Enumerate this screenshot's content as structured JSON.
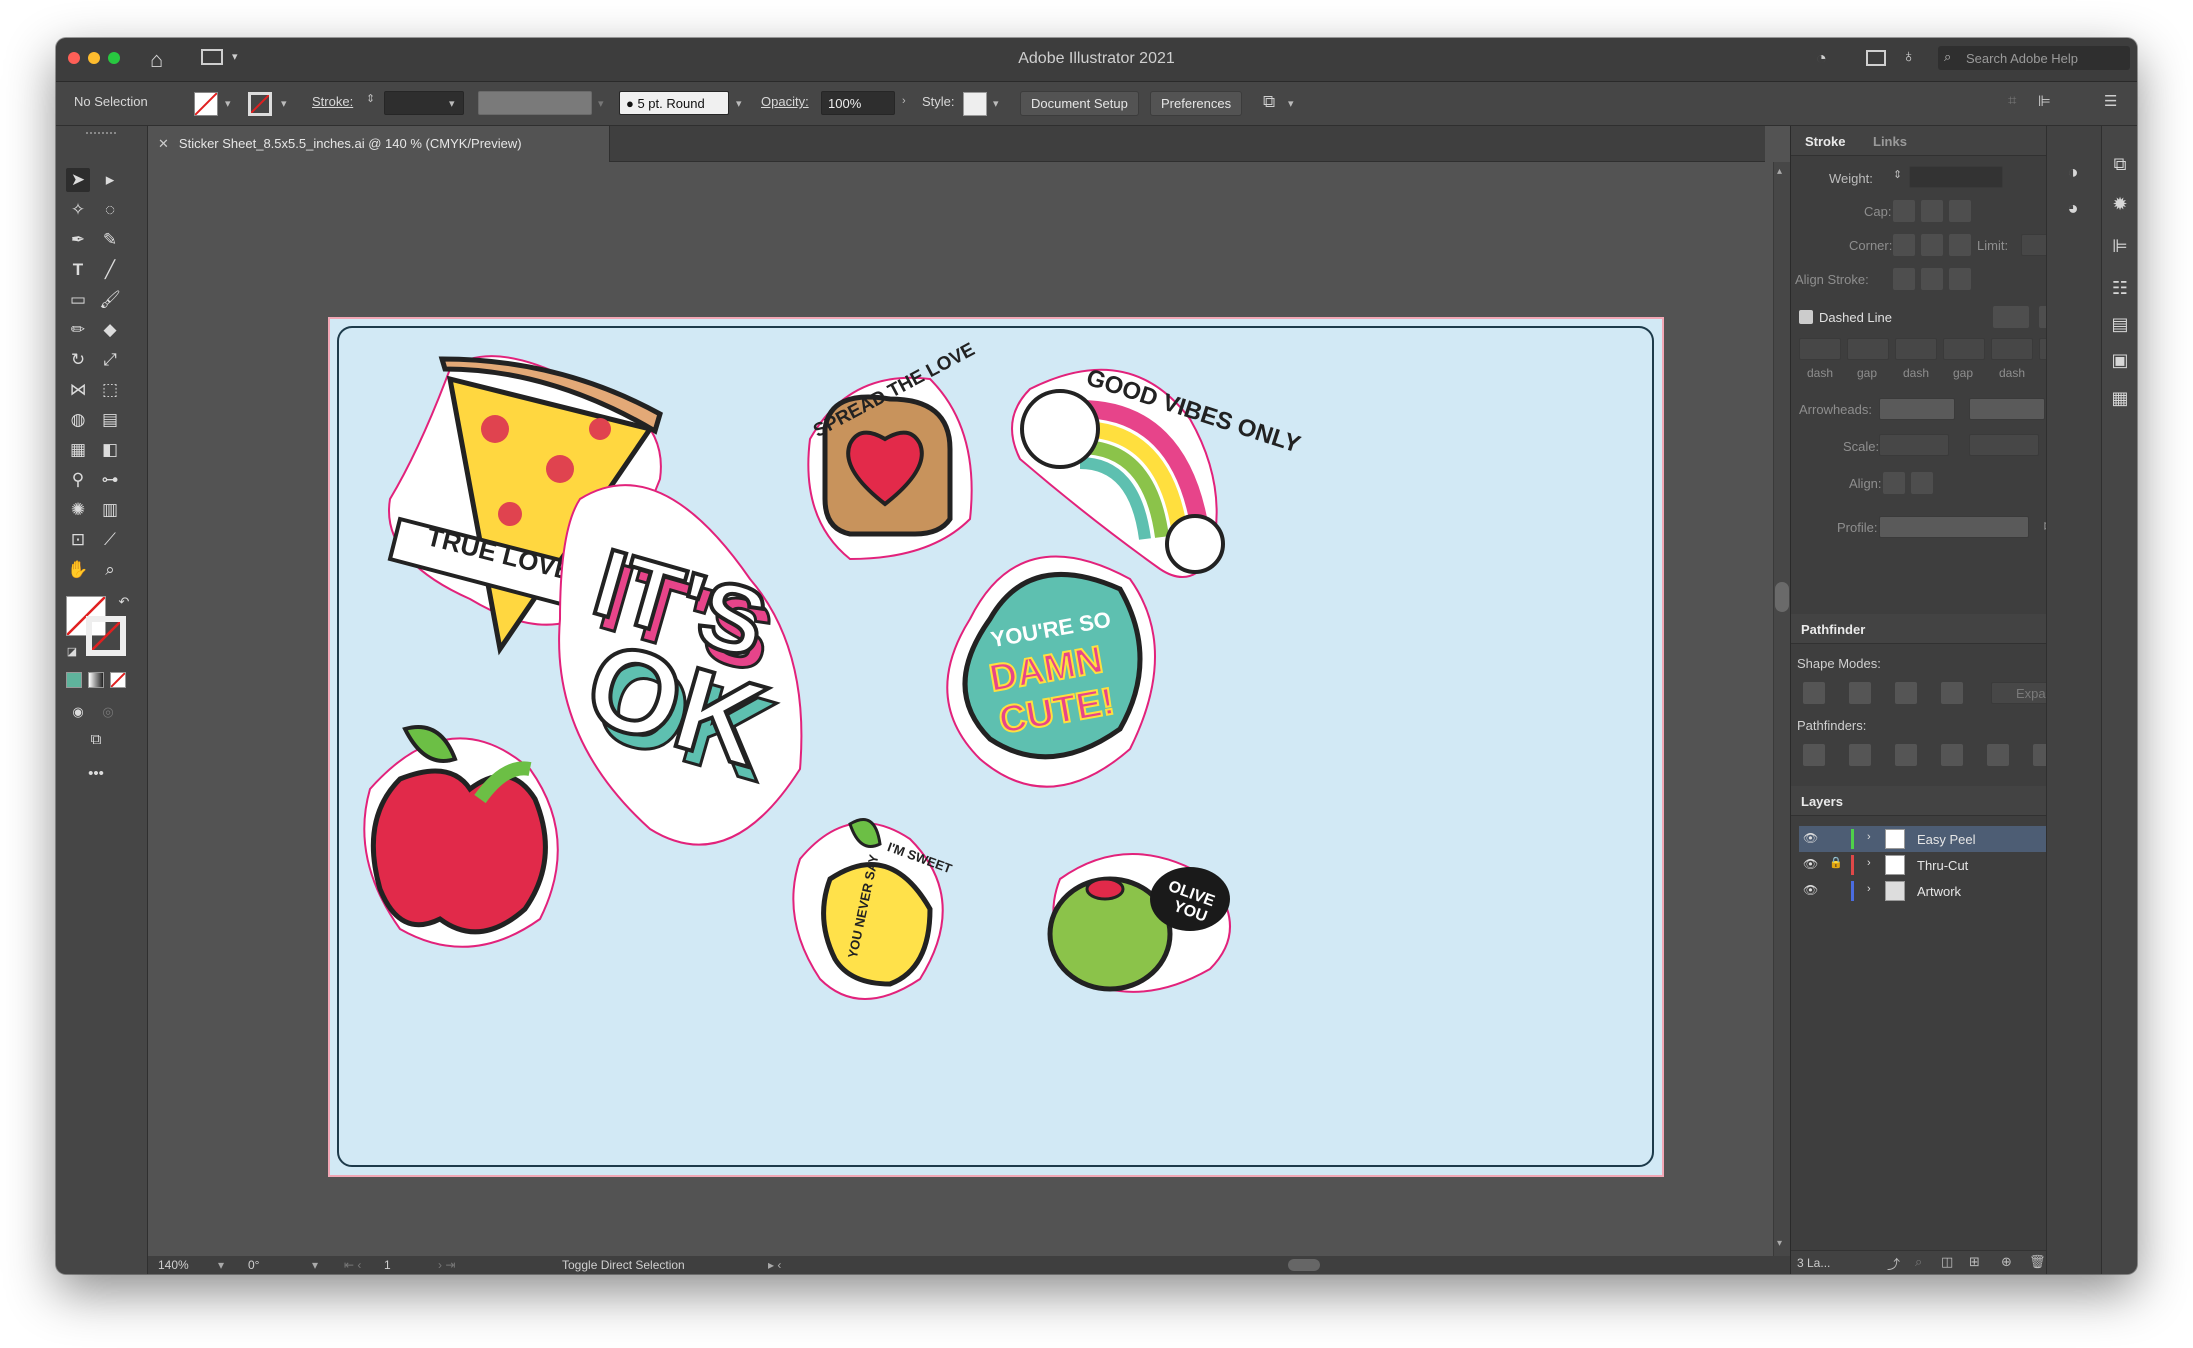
{
  "window": {
    "title": "Adobe Illustrator 2021",
    "search_placeholder": "Search Adobe Help"
  },
  "control_bar": {
    "selection": "No Selection",
    "stroke_label": "Stroke:",
    "brush": "5 pt. Round",
    "opacity_label": "Opacity:",
    "opacity_value": "100%",
    "style_label": "Style:",
    "document_setup": "Document Setup",
    "preferences": "Preferences"
  },
  "document": {
    "tab_title": "Sticker Sheet_8.5x5.5_inches.ai @ 140 % (CMYK/Preview)"
  },
  "artboard": {
    "background": "#d2e9f5",
    "cut_line": "#e2227b"
  },
  "stickers": {
    "pizza_banner": "TRUE LOVE",
    "toast_text": "SPREAD THE LOVE",
    "rainbow_text": "GOOD VIBES ONLY",
    "its_ok_line1": "IT'S",
    "its_ok_line2": "OK",
    "cloud_text_1": "YOU'RE SO",
    "cloud_text_2": "DAMN",
    "cloud_text_3": "CUTE!",
    "lemon_text_1": "YOU NEVER SAY",
    "lemon_text_2": "I'M SWEET",
    "olive_text_1": "OLIVE",
    "olive_text_2": "YOU"
  },
  "status_bar": {
    "zoom": "140%",
    "rotation": "0°",
    "page": "1",
    "tool_hint": "Toggle Direct Selection"
  },
  "stroke_panel": {
    "tabs": [
      "Stroke",
      "Links"
    ],
    "weight": "Weight:",
    "cap": "Cap:",
    "corner": "Corner:",
    "limit": "Limit:",
    "align_stroke": "Align Stroke:",
    "dashed_line": "Dashed Line",
    "dash_labels": [
      "dash",
      "gap",
      "dash",
      "gap",
      "dash",
      "gap"
    ],
    "arrowheads": "Arrowheads:",
    "scale": "Scale:",
    "align": "Align:",
    "profile": "Profile:"
  },
  "pathfinder_panel": {
    "title": "Pathfinder",
    "shape_modes": "Shape Modes:",
    "expand": "Expand",
    "pathfinders": "Pathfinders:"
  },
  "layers_panel": {
    "title": "Layers",
    "layers": [
      {
        "name": "Easy Peel",
        "color": "#4fd14a"
      },
      {
        "name": "Thru-Cut",
        "color": "#e04848"
      },
      {
        "name": "Artwork",
        "color": "#4a6ce0"
      }
    ],
    "count": "3 La..."
  }
}
